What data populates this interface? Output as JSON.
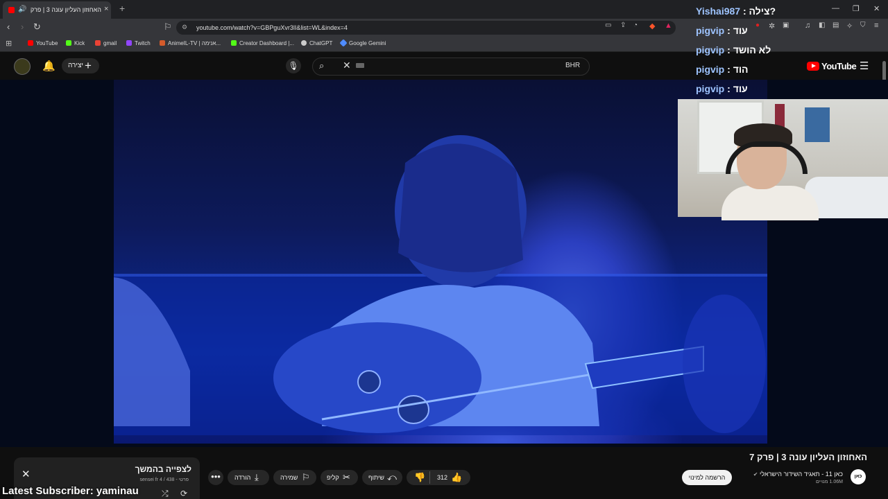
{
  "browser": {
    "tab_title": "האחוזון העליון עונה 3 | פרק 7",
    "url": "youtube.com/watch?v=GBPguXvr3lI&list=WL&index=4",
    "bookmarks": [
      {
        "label": "YouTube",
        "color": "#ff0000"
      },
      {
        "label": "Kick",
        "color": "#53fc18"
      },
      {
        "label": "gmail",
        "color": "#ea4335"
      },
      {
        "label": "Twitch",
        "color": "#9146ff"
      },
      {
        "label": "AnimeIL-TV | אנימה...",
        "color": "#d45b2b"
      },
      {
        "label": "Creator Dashboard |...",
        "color": "#53fc18"
      },
      {
        "label": "ChatGPT",
        "color": "#cccccc"
      },
      {
        "label": "Google Gemini",
        "color": "#4f8cff"
      }
    ]
  },
  "youtube": {
    "create_label": "יצירה",
    "search_region": "BHR",
    "logo_text": "YouTube",
    "video_title": "האחוזון העליון עונה 3 | פרק 7",
    "channel_name": "כאן 11 - תאגיד השידור הישראלי",
    "channel_avatar_text": "כאן",
    "subscribers": "1.06M מנויים",
    "subscribe_label": "הרשמה למינוי",
    "likes": "312",
    "share_label": "שיתוף",
    "clip_label": "קליפ",
    "save_label": "שמירה",
    "download_label": "הורדה"
  },
  "playlist": {
    "title": "לצפייה בהמשך",
    "subtitle": "sensei fr פרטי - 438 / 4"
  },
  "stream_overlay": {
    "chat": [
      {
        "user": "Yishai987",
        "message": "צילה?"
      },
      {
        "user": "pigvip",
        "message": "עוד"
      },
      {
        "user": "pigvip",
        "message": "לא הושד"
      },
      {
        "user": "pigvip",
        "message": "הוד"
      },
      {
        "user": "pigvip",
        "message": "עוד"
      }
    ],
    "latest_subscriber": "Latest Subscriber: yaminau"
  }
}
